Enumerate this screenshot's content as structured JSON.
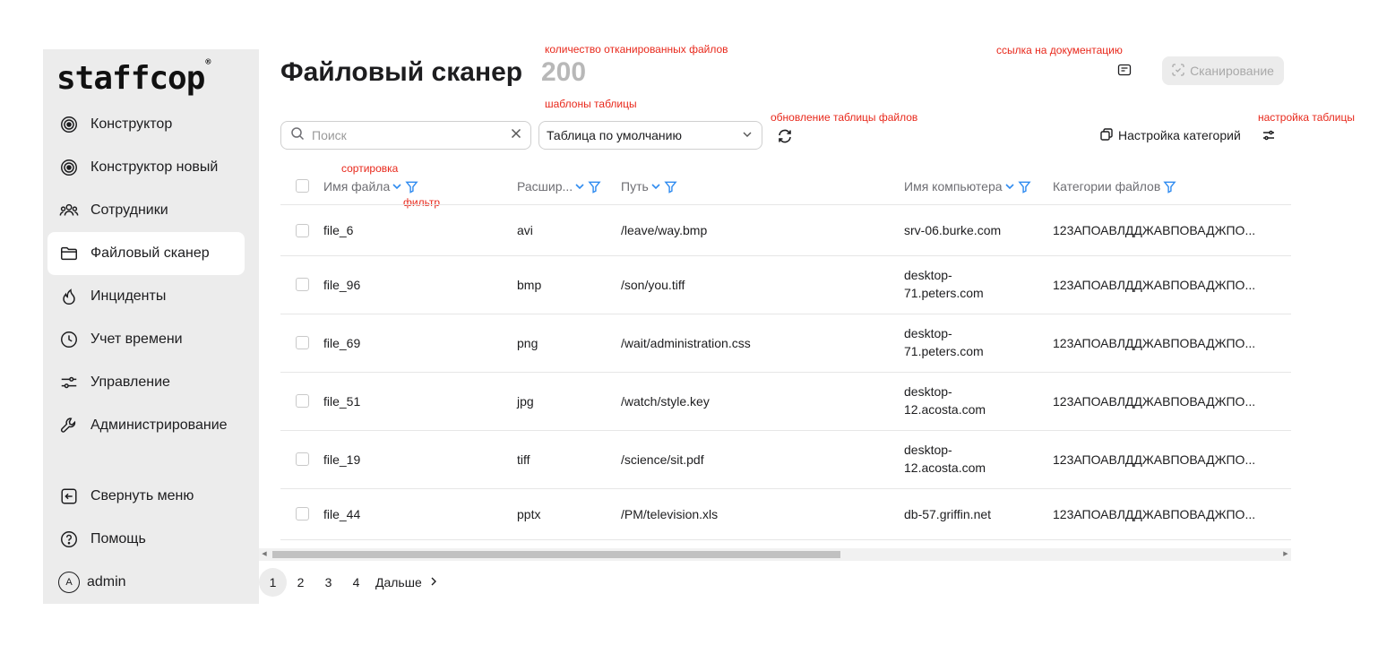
{
  "sidebar": {
    "logo": "staffcop",
    "logo_mark": "®",
    "items": [
      {
        "label": "Конструктор",
        "icon": "target-icon"
      },
      {
        "label": "Конструктор новый",
        "icon": "target-icon"
      },
      {
        "label": "Сотрудники",
        "icon": "users-icon"
      },
      {
        "label": "Файловый сканер",
        "icon": "folder-icon",
        "active": true
      },
      {
        "label": "Инциденты",
        "icon": "flame-icon"
      },
      {
        "label": "Учет времени",
        "icon": "clock-icon"
      },
      {
        "label": "Управление",
        "icon": "sliders-icon"
      },
      {
        "label": "Администрирование",
        "icon": "wrench-icon"
      }
    ],
    "bottom": [
      {
        "label": "Свернуть меню",
        "icon": "collapse-icon"
      },
      {
        "label": "Помощь",
        "icon": "help-icon"
      }
    ],
    "user": {
      "avatar": "A",
      "name": "admin"
    }
  },
  "header": {
    "title": "Файловый сканер",
    "count": "200",
    "scan_label": "Сканирование"
  },
  "annotations": {
    "count": "количество отканированных файлов",
    "docs": "ссылка на документацию",
    "templates": "шаблоны таблицы",
    "refresh": "обновление таблицы файлов",
    "table_settings": "настройка таблицы",
    "sort": "сортировка",
    "filter": "фильтр"
  },
  "toolbar": {
    "search_placeholder": "Поиск",
    "template_value": "Таблица по умолчанию",
    "categories_label": "Настройка категорий"
  },
  "table": {
    "columns": [
      "Имя файла",
      "Расшир...",
      "Путь",
      "Имя компьютера",
      "Категории файлов"
    ],
    "rows": [
      {
        "name": "file_6",
        "ext": "avi",
        "path": "/leave/way.bmp",
        "host1": "srv-06.burke.com",
        "host2": "",
        "cat": "123АПОАВЛДДЖАВПОВАДЖПО..."
      },
      {
        "name": "file_96",
        "ext": "bmp",
        "path": "/son/you.tiff",
        "host1": "desktop-",
        "host2": "71.peters.com",
        "cat": "123АПОАВЛДДЖАВПОВАДЖПО..."
      },
      {
        "name": "file_69",
        "ext": "png",
        "path": "/wait/administration.css",
        "host1": "desktop-",
        "host2": "71.peters.com",
        "cat": "123АПОАВЛДДЖАВПОВАДЖПО..."
      },
      {
        "name": "file_51",
        "ext": "jpg",
        "path": "/watch/style.key",
        "host1": "desktop-",
        "host2": "12.acosta.com",
        "cat": "123АПОАВЛДДЖАВПОВАДЖПО..."
      },
      {
        "name": "file_19",
        "ext": "tiff",
        "path": "/science/sit.pdf",
        "host1": "desktop-",
        "host2": "12.acosta.com",
        "cat": "123АПОАВЛДДЖАВПОВАДЖПО..."
      },
      {
        "name": "file_44",
        "ext": "pptx",
        "path": "/PM/television.xls",
        "host1": "db-57.griffin.net",
        "host2": "",
        "cat": "123АПОАВЛДДЖАВПОВАДЖПО..."
      }
    ]
  },
  "pagination": {
    "pages": [
      "1",
      "2",
      "3",
      "4"
    ],
    "current": "1",
    "next_label": "Дальше"
  },
  "colors": {
    "accent": "#2f8bf0",
    "annotation": "#e8281b",
    "sidebar_bg": "#ececec",
    "muted": "#b8b8b8"
  }
}
